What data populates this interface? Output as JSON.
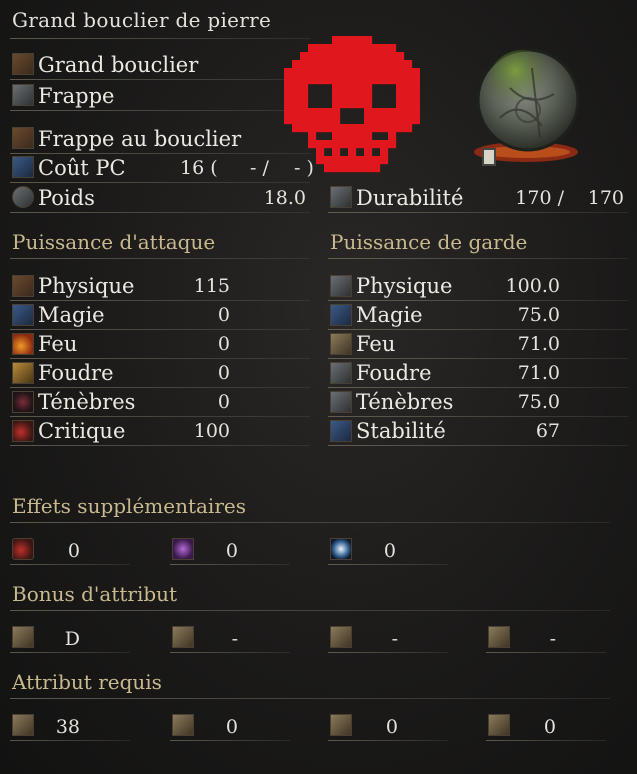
{
  "item": {
    "name": "Grand bouclier de pierre",
    "category": "Grand bouclier",
    "attack_type": "Frappe",
    "skill": "Frappe au bouclier",
    "fp_cost_label": "Coût PC",
    "fp_cost_value": "16 (",
    "fp_cost_range": "- /",
    "fp_cost_end": "- )",
    "weight_label": "Poids",
    "weight_value": "18.0",
    "durability_label": "Durabilité",
    "durability_current": "170 /",
    "durability_max": "170"
  },
  "attack_power": {
    "heading": "Puissance d'attaque",
    "rows": [
      {
        "label": "Physique",
        "value": "115"
      },
      {
        "label": "Magie",
        "value": "0"
      },
      {
        "label": "Feu",
        "value": "0"
      },
      {
        "label": "Foudre",
        "value": "0"
      },
      {
        "label": "Ténèbres",
        "value": "0"
      },
      {
        "label": "Critique",
        "value": "100"
      }
    ]
  },
  "guard": {
    "heading": "Puissance de garde",
    "rows": [
      {
        "label": "Physique",
        "value": "100.0"
      },
      {
        "label": "Magie",
        "value": "75.0"
      },
      {
        "label": "Feu",
        "value": "71.0"
      },
      {
        "label": "Foudre",
        "value": "71.0"
      },
      {
        "label": "Ténèbres",
        "value": "75.0"
      },
      {
        "label": "Stabilité",
        "value": "67"
      }
    ]
  },
  "effects": {
    "heading": "Effets supplémentaires",
    "values": [
      "0",
      "0",
      "0"
    ]
  },
  "scaling": {
    "heading": "Bonus d'attribut",
    "values": [
      "D",
      "-",
      "-",
      "-"
    ]
  },
  "requirements": {
    "heading": "Attribut requis",
    "values": [
      "38",
      "0",
      "0",
      "0"
    ]
  },
  "colors": {
    "skull": "#e0181e",
    "section_heading": "#c9b98f"
  }
}
